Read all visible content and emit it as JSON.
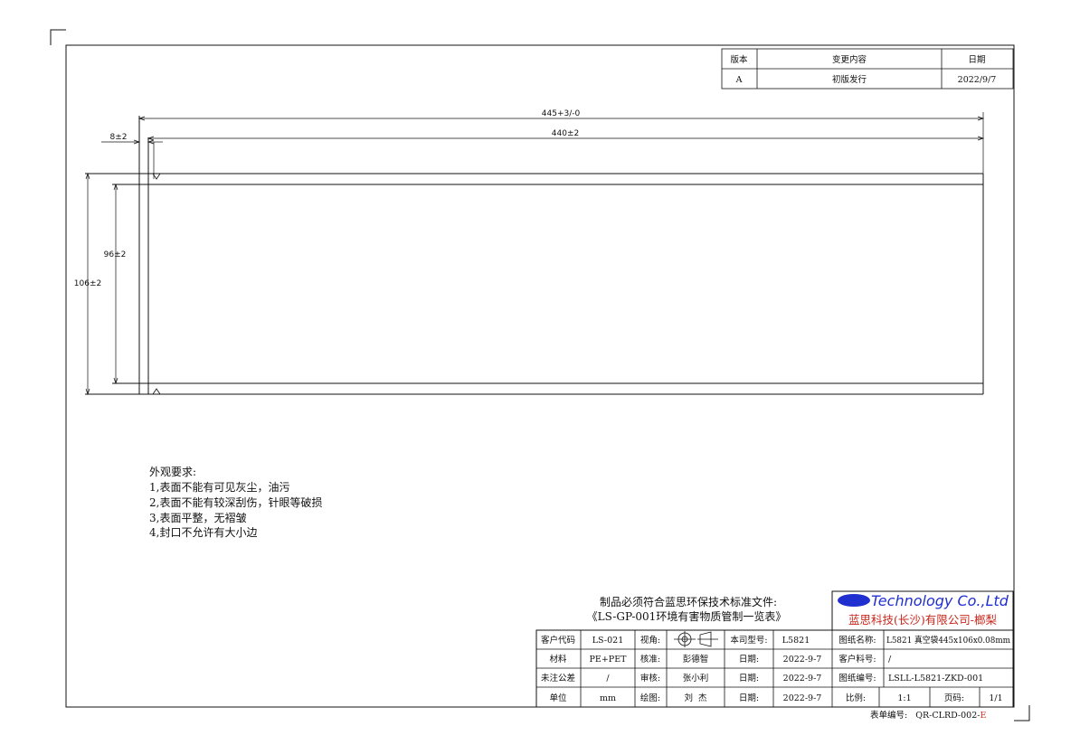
{
  "revision_table": {
    "headers": {
      "version": "版本",
      "change": "变更内容",
      "date": "日期"
    },
    "rows": [
      {
        "version": "A",
        "change": "初版发行",
        "date": "2022/9/7"
      }
    ]
  },
  "dimensions": {
    "overall_length": "445+3/-0",
    "inner_length": "440±2",
    "offset": "8±2",
    "inner_height": "96±2",
    "overall_height": "106±2"
  },
  "requirements": {
    "title": "外观要求:",
    "items": [
      "1,表面不能有可见灰尘，油污",
      "2,表面不能有较深刮伤，针眼等破损",
      "3,表面平整，无褶皱",
      "4,封口不允许有大小边"
    ]
  },
  "notice": {
    "line1": "制品必须符合蓝思环保技术标准文件:",
    "line2": "《LS-GP-001环境有害物质管制一览表》"
  },
  "company": {
    "name_en": "Technology Co.,Ltd",
    "name_cn": "蓝思科技(长沙)有限公司-榔梨",
    "brand_color": "#1f2fd0",
    "accent_color": "#c8281e"
  },
  "title_block": {
    "customer_code_label": "客户代码",
    "customer_code": "LS-021",
    "view_label": "视角:",
    "model_label": "本司型号:",
    "model": "L5821",
    "drawing_name_label": "图纸名称:",
    "drawing_name": "L5821 真空袋445x106x0.08mm",
    "material_label": "材料",
    "material": "PE+PET",
    "checker_label": "核准:",
    "checker": "彭德智",
    "date_label": "日期:",
    "date1": "2022-9-7",
    "customer_part_label": "客户料号:",
    "customer_part": "/",
    "tolerance_label": "未注公差",
    "tolerance": "/",
    "reviewer_label": "审核:",
    "reviewer": "张小利",
    "date2": "2022-9-7",
    "drawing_no_label": "图纸编号:",
    "drawing_no": "LSLL-L5821-ZKD-001",
    "unit_label": "单位",
    "unit": "mm",
    "drawer_label": "绘图:",
    "drawer": "刘  杰",
    "date3": "2022-9-7",
    "scale_label": "比例:",
    "scale": "1:1",
    "page_label": "页码:",
    "page": "1/1"
  },
  "form_number": {
    "label": "表单编号:",
    "value": "QR-CLRD-002-",
    "suffix": "E"
  }
}
